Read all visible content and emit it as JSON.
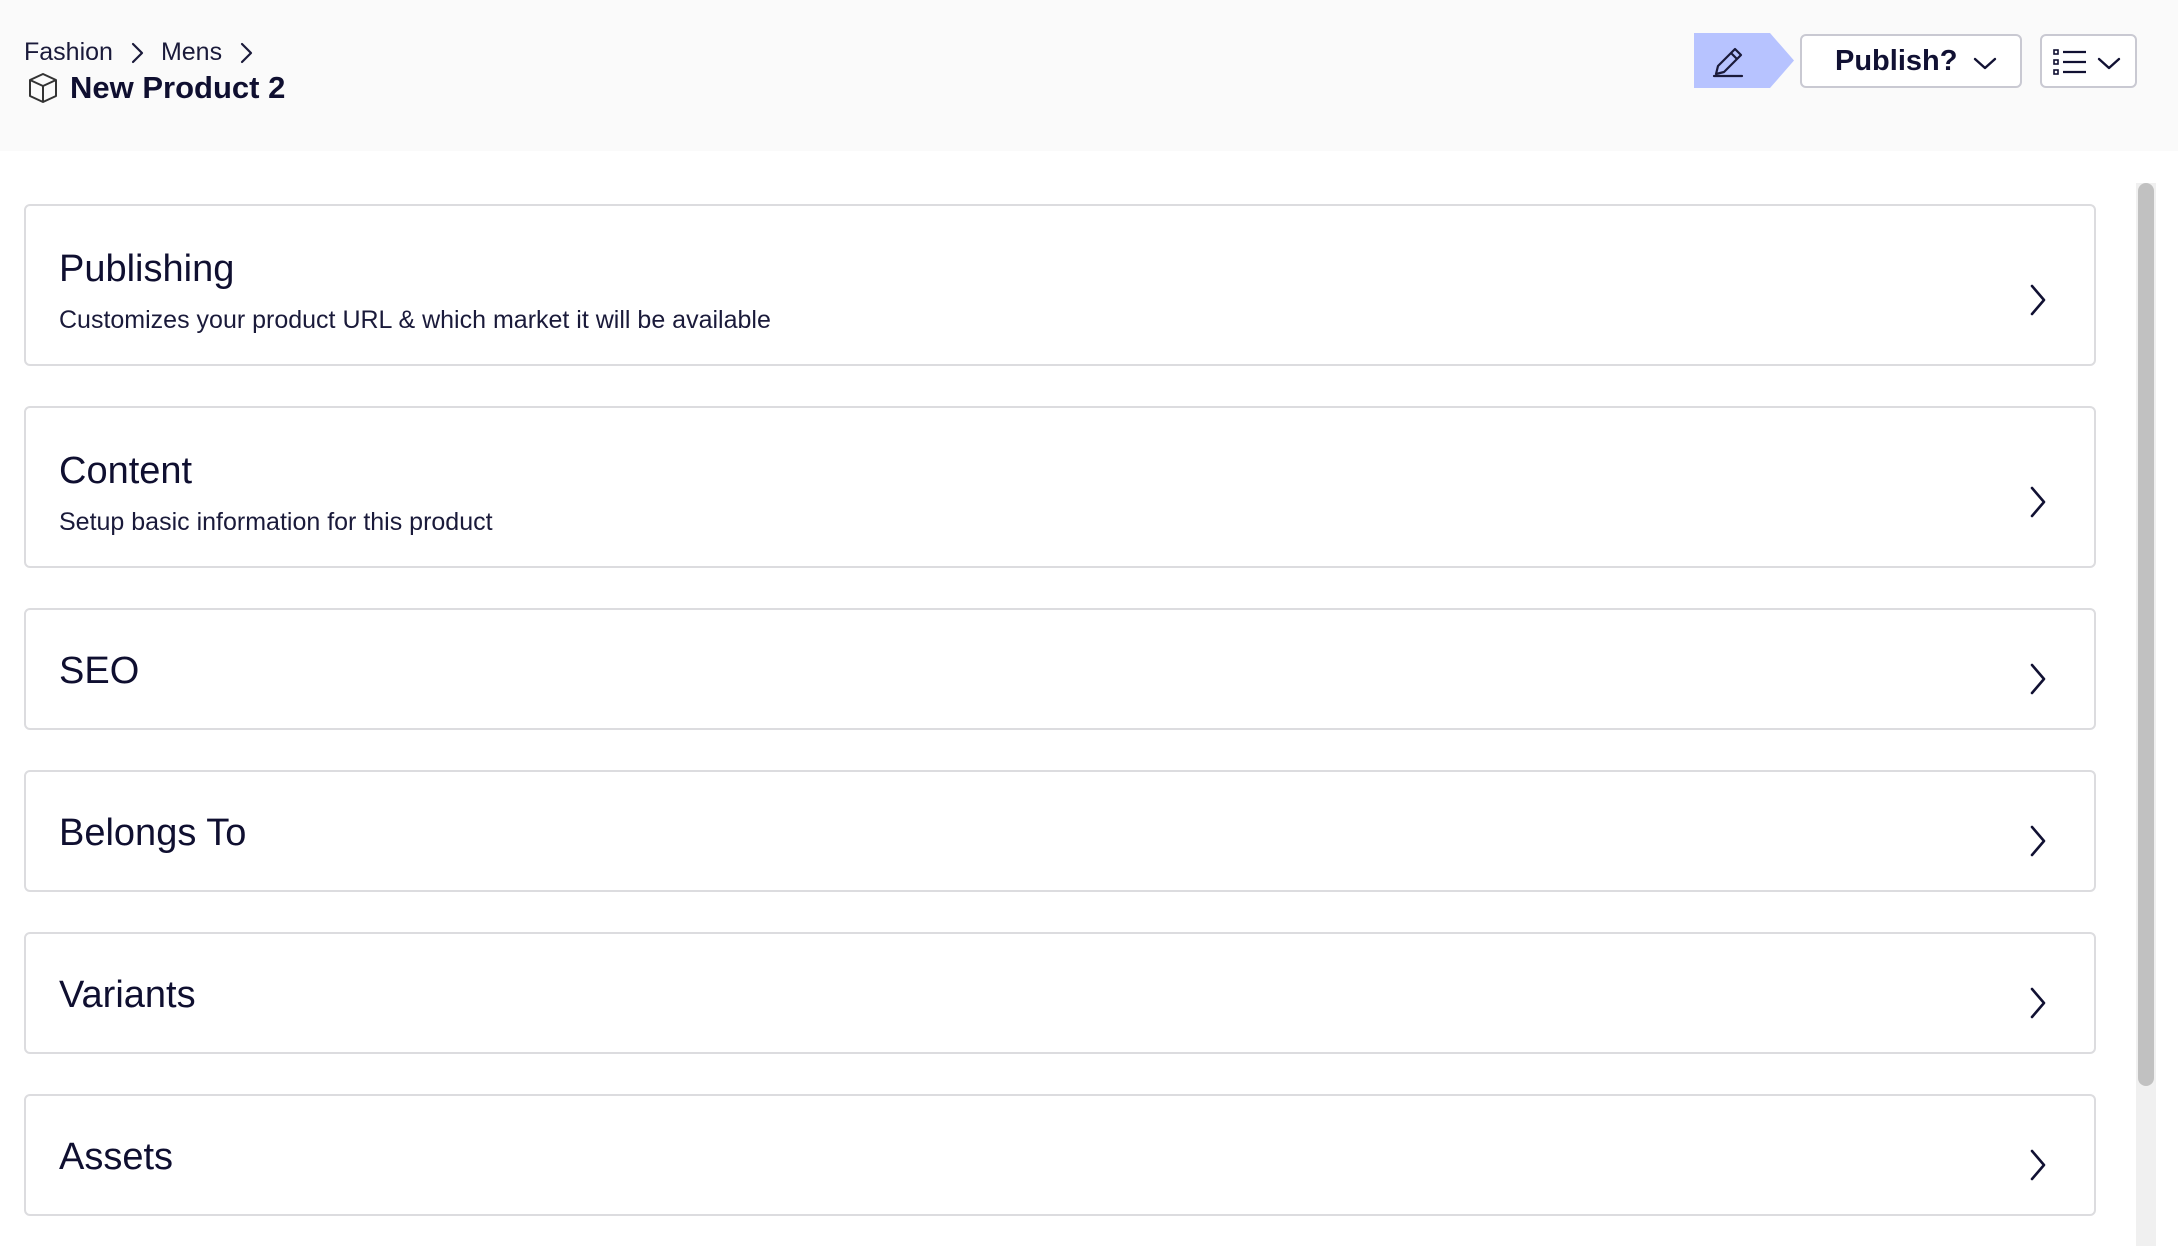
{
  "breadcrumb": {
    "items": [
      "Fashion",
      "Mens"
    ]
  },
  "page": {
    "title": "New Product 2",
    "icon": "cube-icon"
  },
  "toolbar": {
    "edit_icon": "pencil-icon",
    "publish_label": "Publish?",
    "publish_menu_icon": "chevron-down-icon",
    "list_icon": "list-icon"
  },
  "sections": [
    {
      "title": "Publishing",
      "description": "Customizes your product URL & which market it will be available"
    },
    {
      "title": "Content",
      "description": "Setup basic information for this product"
    },
    {
      "title": "SEO",
      "description": ""
    },
    {
      "title": "Belongs To",
      "description": ""
    },
    {
      "title": "Variants",
      "description": ""
    },
    {
      "title": "Assets",
      "description": ""
    }
  ],
  "colors": {
    "header_bg": "#fafafa",
    "edit_tag": "#b7c3ff",
    "text": "#0f0f30",
    "border": "#dcdcdf"
  }
}
